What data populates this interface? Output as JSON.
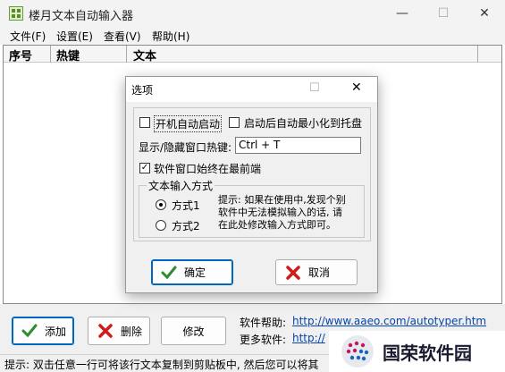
{
  "window": {
    "title": "楼月文本自动输入器",
    "controls": {
      "minimize": "—",
      "maximize": "☐",
      "close": "✕"
    }
  },
  "menu": [
    "文件(F)",
    "设置(E)",
    "查看(V)",
    "帮助(H)"
  ],
  "table": {
    "columns": [
      "序号",
      "热键",
      "文本"
    ]
  },
  "bottom": {
    "add_label": "添加",
    "delete_label": "删除",
    "edit_label": "修改",
    "help_label": "软件帮助:",
    "help_link": "http://www.aaeo.com/autotyper.htm",
    "more_label": "更多软件:",
    "more_link": "http://"
  },
  "status": "提示: 双击任意一行可将该行文本复制到剪贴板中, 然后您可以将其",
  "dialog": {
    "title": "选项",
    "controls": {
      "maximize": "☐",
      "close": "✕"
    },
    "startup_label": "开机自动启动",
    "startup_checked": false,
    "minimize_label": "启动后自动最小化到托盘",
    "minimize_checked": false,
    "hotkey_label": "显示/隐藏窗口热键:",
    "hotkey_value": "Ctrl + T",
    "topmost_label": "软件窗口始终在最前端",
    "topmost_checked": true,
    "group_label": "文本输入方式",
    "mode1_label": "方式1",
    "mode2_label": "方式2",
    "selected_mode": 1,
    "tip_lines": [
      "提示: 如果在使用中,发现个别",
      "软件中无法模拟输入的话, 请",
      "在此处修改输入方式即可。"
    ],
    "ok_label": "确定",
    "cancel_label": "取消"
  },
  "watermark": {
    "text": "国荣软件园"
  },
  "colors": {
    "ok_check": "#2e8b2e",
    "cancel_x": "#d11a1a",
    "link": "#0645ad",
    "dialog_focus": "#0067c0"
  }
}
